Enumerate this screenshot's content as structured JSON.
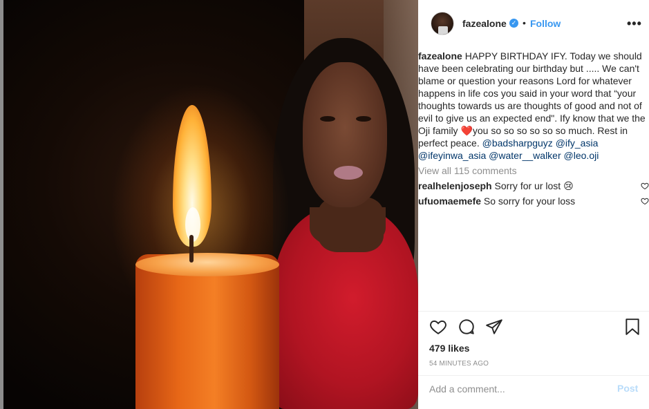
{
  "post": {
    "username": "fazealone",
    "follow_label": "Follow",
    "dot": "•",
    "more_label": "•••",
    "verified_mark": "✓"
  },
  "caption": {
    "username": "fazealone",
    "text_1": " HAPPY BIRTHDAY IFY. Today we should have been celebrating our birthday but ..... We can't blame or question your reasons Lord for whatever happens in life cos you said in your word that “your thoughts towards us are thoughts of good and not of evil to give us an expected end\". Ify know that we the Oji family ",
    "heart_emoji": "❤️",
    "text_2": "you so so so so so so much. Rest in perfect peace. ",
    "mentions": [
      "@badsharpguyz",
      "@ify_asia",
      "@ifeyinwa_asia",
      "@water__walker",
      "@leo.oji"
    ]
  },
  "view_all_comments": "View all 115 comments",
  "comments": [
    {
      "username": "realhelenjoseph",
      "text": "Sorry for ur lost 😢"
    },
    {
      "username": "ufuomaemefe",
      "text": "So sorry for your loss"
    }
  ],
  "likes": "479 likes",
  "timestamp": "54 MINUTES AGO",
  "add_comment": {
    "placeholder": "Add a comment...",
    "post_label": "Post"
  },
  "colors": {
    "link": "#3897f0",
    "mention": "#003569",
    "muted": "#8e8e8e",
    "post_disabled": "#b9dcfa"
  },
  "icons": [
    "heart-icon",
    "comment-icon",
    "share-icon",
    "bookmark-icon",
    "verified-badge-icon",
    "more-options-icon"
  ]
}
